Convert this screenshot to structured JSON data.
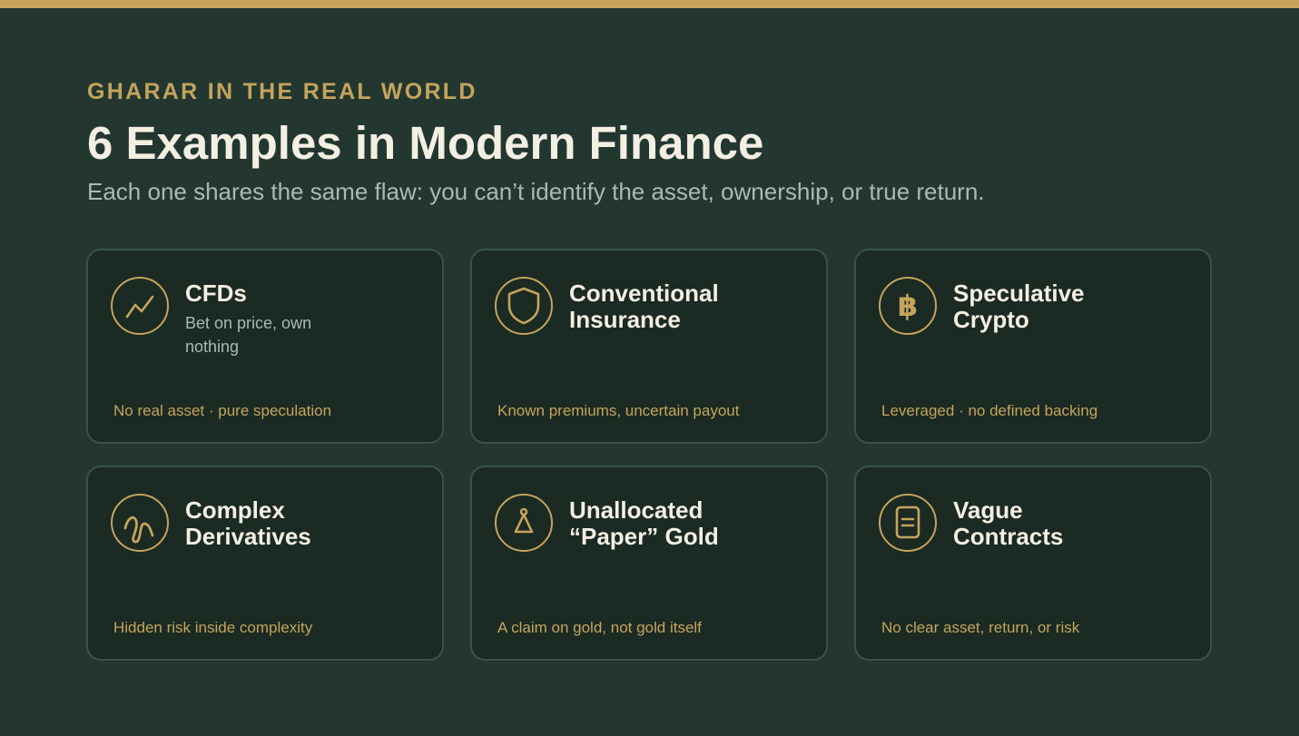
{
  "header": {
    "eyebrow": "GHARAR IN THE REAL WORLD",
    "title": "6 Examples in Modern Finance",
    "subtitle": "Each one shares the same flaw: you can’t identify the asset, ownership, or true return."
  },
  "colors": {
    "background": "#233730",
    "accent_gold": "#c4a45c",
    "card_background": "#1b2a23",
    "card_border": "#3a5148",
    "title_text": "#f3efe3",
    "muted_text": "#a9bab2"
  },
  "cards": [
    {
      "icon": "trend-line-icon",
      "title": "CFDs",
      "subtitle": "Bet on price, own nothing",
      "note": "No real asset · pure speculation"
    },
    {
      "icon": "shield-icon",
      "title": "Conventional\nInsurance",
      "note": "Known premiums, uncertain payout"
    },
    {
      "icon": "bitcoin-icon",
      "title": "Speculative\nCrypto",
      "note": "Leveraged · no defined backing"
    },
    {
      "icon": "squiggle-icon",
      "title": "Complex\nDerivatives",
      "note": "Hidden risk inside complexity"
    },
    {
      "icon": "gold-tag-icon",
      "title": "Unallocated\n“Paper” Gold",
      "note": "A claim on gold, not gold itself"
    },
    {
      "icon": "document-icon",
      "title": "Vague\nContracts",
      "note": "No clear asset, return, or risk"
    }
  ]
}
